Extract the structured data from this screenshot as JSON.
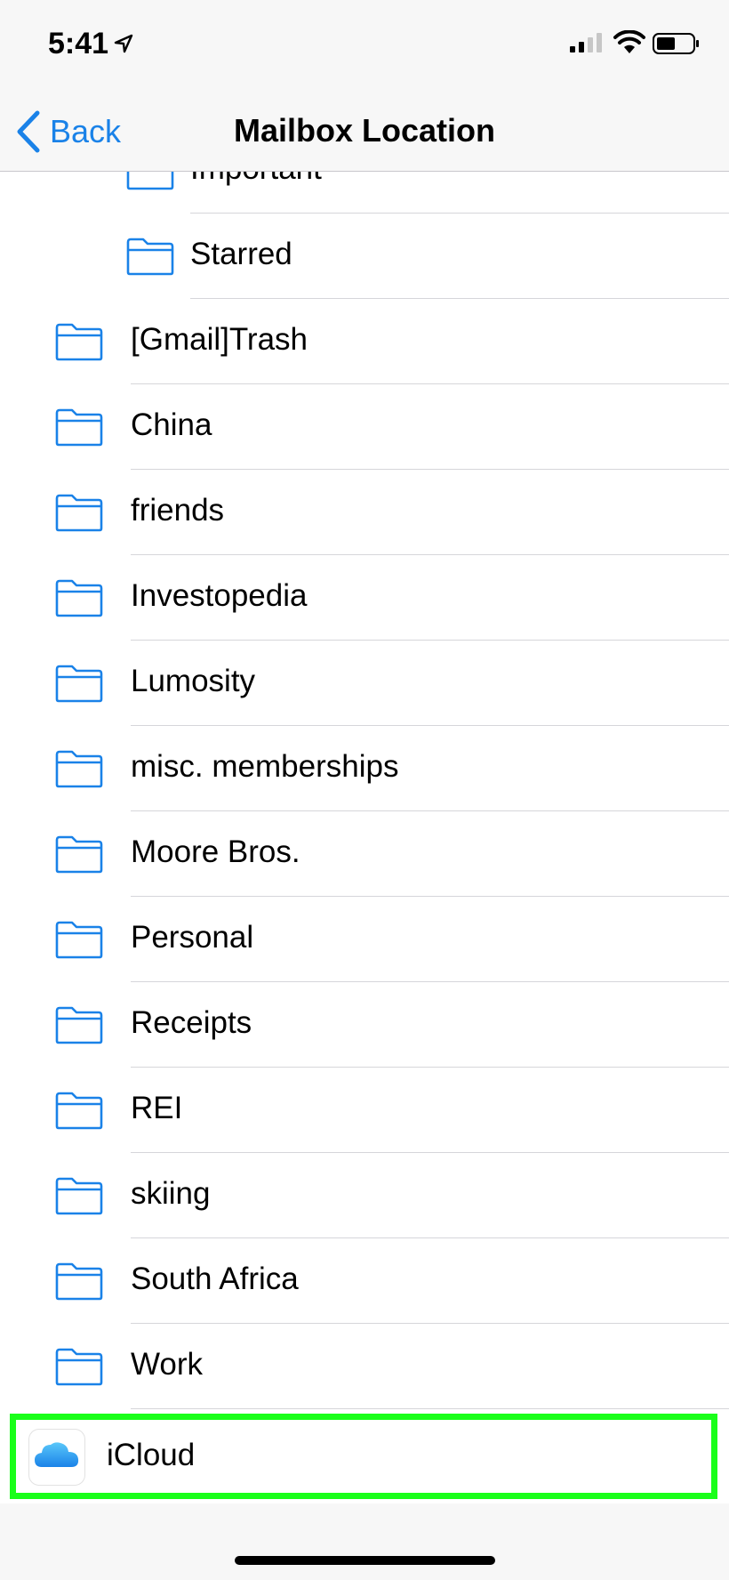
{
  "status": {
    "time": "5:41"
  },
  "nav": {
    "back_label": "Back",
    "title": "Mailbox Location"
  },
  "colors": {
    "accent": "#1a82e8",
    "highlight": "#1aff1a"
  },
  "subfolders": [
    {
      "label": "Important",
      "icon": "folder-icon"
    },
    {
      "label": "Starred",
      "icon": "folder-icon"
    }
  ],
  "folders": [
    {
      "label": "[Gmail]Trash",
      "icon": "folder-icon"
    },
    {
      "label": "China",
      "icon": "folder-icon"
    },
    {
      "label": "friends",
      "icon": "folder-icon"
    },
    {
      "label": "Investopedia",
      "icon": "folder-icon"
    },
    {
      "label": "Lumosity",
      "icon": "folder-icon"
    },
    {
      "label": "misc. memberships",
      "icon": "folder-icon"
    },
    {
      "label": "Moore Bros.",
      "icon": "folder-icon"
    },
    {
      "label": "Personal",
      "icon": "folder-icon"
    },
    {
      "label": "Receipts",
      "icon": "folder-icon"
    },
    {
      "label": "REI",
      "icon": "folder-icon"
    },
    {
      "label": "skiing",
      "icon": "folder-icon"
    },
    {
      "label": "South Africa",
      "icon": "folder-icon"
    },
    {
      "label": "Work",
      "icon": "folder-icon"
    }
  ],
  "account": {
    "label": "iCloud",
    "icon": "icloud-icon"
  }
}
